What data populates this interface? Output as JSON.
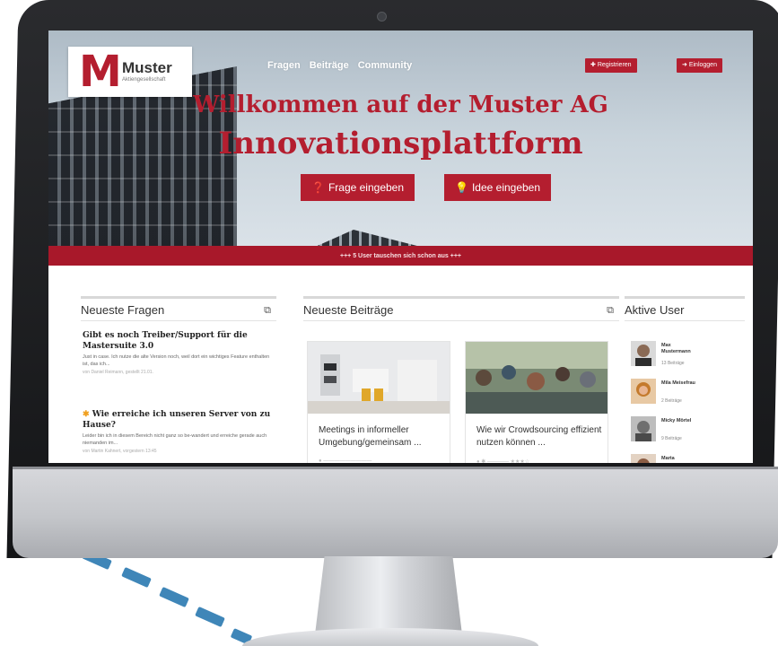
{
  "site": {
    "logo": {
      "letter": "M",
      "name": "Muster",
      "sub": "Aktiengesellschaft"
    },
    "nav": [
      "Fragen",
      "Beiträge",
      "Community"
    ],
    "auth": {
      "register": "Registrieren",
      "login": "Einloggen"
    },
    "hero": {
      "title_line1": "Willkommen auf der Muster AG",
      "title_line2": "Innovationsplattform",
      "cta_question": "Frage eingeben",
      "cta_idea": "Idee eingeben",
      "banner": "+++ 5 User tauschen sich schon aus +++"
    }
  },
  "questions": {
    "header": "Neueste Fragen",
    "items": [
      {
        "title": "Gibt es noch Treiber/Support für die Mastersuite 3.0",
        "body": "Just in case. Ich nutze die alte Version noch, weil dort ein wichtiges Feature enthalten ist, das ich...",
        "meta": "von Daniel Reimann, gestellt 21.01."
      },
      {
        "title": "Wie erreiche ich unseren Server von zu Hause?",
        "body": "Leider bin ich in diesem Bereich nicht ganz so be-wandert und erreiche gerade auch niemanden im...",
        "meta": "von Martin Kahnert, vorgestern 13:45"
      }
    ]
  },
  "posts": {
    "header": "Neueste Beiträge",
    "items": [
      {
        "title": "Meetings in informeller Umgebung/gemeinsam ..."
      },
      {
        "title": "Wie wir Crowdsourcing effizient nutzen können ..."
      }
    ]
  },
  "users": {
    "header": "Aktive User",
    "items": [
      {
        "name": "Max Mustermann",
        "count": "13 Beiträge"
      },
      {
        "name": "Mila Meisefrau",
        "count": "2 Beiträge"
      },
      {
        "name": "Micky Mörtel",
        "count": "9 Beiträge"
      },
      {
        "name": "Marta",
        "count": ""
      }
    ]
  },
  "colors": {
    "brand": "#b41e2f",
    "dashes": "#3f86b8"
  }
}
